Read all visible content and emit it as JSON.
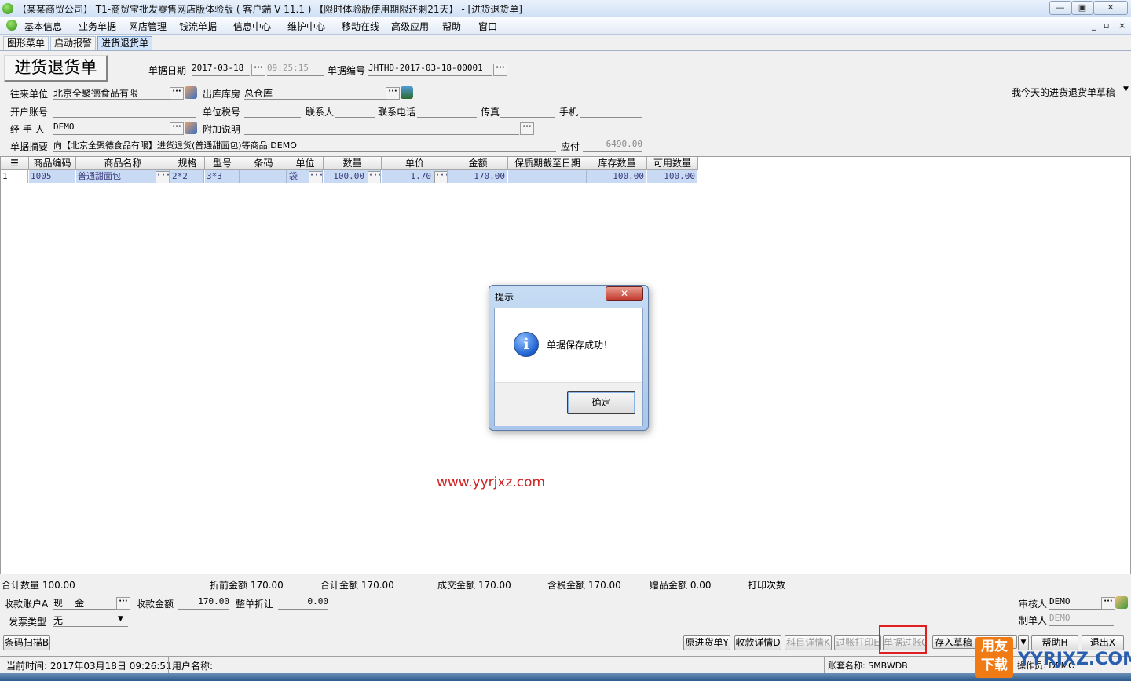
{
  "window": {
    "title": "【某某商贸公司】 T1-商贸宝批发零售网店版体验版 ( 客户端 V 11.1 ) 【限时体验版使用期限还剩21天】 - [进货退货单]",
    "min_label": "—",
    "max_label": "▣",
    "close_label": "✕"
  },
  "menu": {
    "items": [
      "基本信息",
      "业务单据",
      "网店管理",
      "钱流单据",
      "信息中心",
      "维护中心",
      "移动在线",
      "高级应用",
      "帮助",
      "窗口"
    ],
    "mdi_min": "_",
    "mdi_restore": "▫",
    "mdi_close": "×"
  },
  "tabs": [
    "图形菜单",
    "启动报警",
    "进货退货单"
  ],
  "form": {
    "doc_title": "进货退货单",
    "date_label": "单据日期",
    "date_value": "2017-03-18",
    "time_value": "09:25:15",
    "number_label": "单据编号",
    "number_value": "JHTHD-2017-03-18-00001",
    "partner_label": "往来单位",
    "partner_value": "北京全聚德食品有限",
    "warehouse_label": "出库库房",
    "warehouse_value": "总仓库",
    "draft_select": "我今天的进货退货单草稿",
    "account_label": "开户账号",
    "taxno_label": "单位税号",
    "contact_label": "联系人",
    "phone_label": "联系电话",
    "fax_label": "传真",
    "mobile_label": "手机",
    "handler_label": "经 手 人",
    "handler_value": "DEMO",
    "note_label": "附加说明",
    "summary_label": "单据摘要",
    "summary_value": "向【北京全聚德食品有限】进货退货(普通甜面包)等商品:DEMO",
    "payable_label": "应付",
    "payable_value": "6490.00"
  },
  "grid": {
    "headers": [
      "商品编码",
      "商品名称",
      "规格",
      "型号",
      "条码",
      "单位",
      "数量",
      "单价",
      "金额",
      "保质期截至日期",
      "库存数量",
      "可用数量"
    ],
    "rows": [
      {
        "idx": "1",
        "code": "1005",
        "name": "普通甜面包",
        "spec": "2*2",
        "model": "3*3",
        "barcode": "",
        "unit": "袋",
        "qty": "100.00",
        "price": "1.70",
        "amount": "170.00",
        "expiry": "",
        "stock": "100.00",
        "avail": "100.00"
      }
    ]
  },
  "totals": {
    "qty": "合计数量 100.00",
    "pre_discount": "折前金额 170.00",
    "sum": "合计金额 170.00",
    "deal": "成交金额 170.00",
    "tax": "含税金额 170.00",
    "gift": "赠品金额 0.00",
    "print": "打印次数"
  },
  "payment": {
    "account_label": "收款账户A",
    "account_value": "现    金",
    "amount_label": "收款金额",
    "amount_value": "170.00",
    "discount_label": "整单折让",
    "discount_value": "0.00",
    "invoice_label": "发票类型",
    "invoice_value": "无",
    "auditor_label": "审核人",
    "auditor_value": "DEMO",
    "maker_label": "制单人",
    "maker_value": "DEMO"
  },
  "buttons": {
    "barcode": "条码扫描B",
    "original": "原进货单Y",
    "receipt_detail": "收款详情D",
    "subject_detail": "科目详情K",
    "post_print": "过账打印E",
    "post": "单据过账G",
    "save_draft": "存入草稿",
    "help": "帮助H",
    "exit": "退出X"
  },
  "status": {
    "time": "当前时间: 2017年03月18日  09:26:51",
    "user": "用户名称:",
    "account_set": "账套名称: SMBWDB",
    "operator": "操作员: DEMO"
  },
  "dialog": {
    "title": "提示",
    "close": "✕",
    "message": "单据保存成功！",
    "ok": "确定",
    "info_glyph": "i"
  },
  "watermark": "www.yyrjxz.com",
  "logo": {
    "line1": "用友",
    "line2": "下载",
    "text": "YYRJXZ.COM"
  },
  "colors": {
    "grid_selected": "#c9dbf4",
    "watermark": "#d02020",
    "highlight_box": "#e02020"
  }
}
